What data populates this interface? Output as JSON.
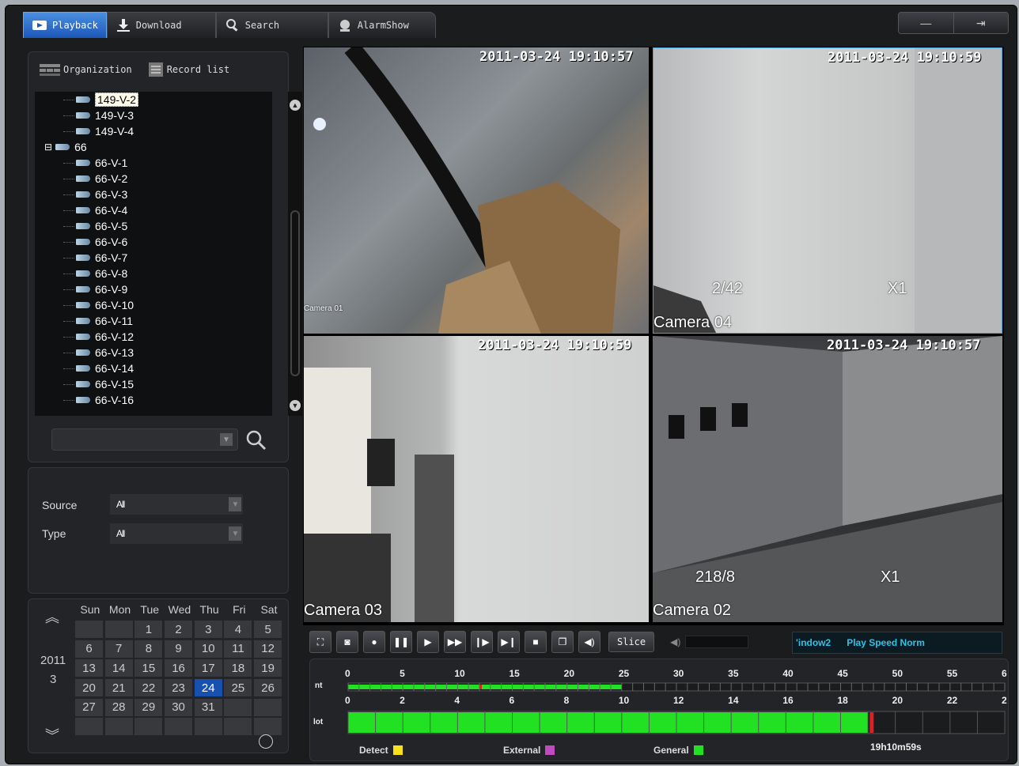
{
  "tabs": [
    {
      "label": "Playback",
      "icon": "playback-icon"
    },
    {
      "label": "Download",
      "icon": "download-icon"
    },
    {
      "label": "Search",
      "icon": "search-icon"
    },
    {
      "label": "AlarmShow",
      "icon": "alarm-icon"
    }
  ],
  "window_controls": {
    "minimize": "—",
    "exit": "⇥"
  },
  "org": {
    "tab_org": "Organization",
    "tab_record": "Record list"
  },
  "tree": [
    {
      "label": "149-V-2",
      "level": 2,
      "selected": true
    },
    {
      "label": "149-V-3",
      "level": 2
    },
    {
      "label": "149-V-4",
      "level": 2
    },
    {
      "label": "66",
      "level": 1,
      "group": true
    },
    {
      "label": "66-V-1",
      "level": 2
    },
    {
      "label": "66-V-2",
      "level": 2
    },
    {
      "label": "66-V-3",
      "level": 2
    },
    {
      "label": "66-V-4",
      "level": 2
    },
    {
      "label": "66-V-5",
      "level": 2
    },
    {
      "label": "66-V-6",
      "level": 2
    },
    {
      "label": "66-V-7",
      "level": 2
    },
    {
      "label": "66-V-8",
      "level": 2
    },
    {
      "label": "66-V-9",
      "level": 2
    },
    {
      "label": "66-V-10",
      "level": 2
    },
    {
      "label": "66-V-11",
      "level": 2
    },
    {
      "label": "66-V-12",
      "level": 2
    },
    {
      "label": "66-V-13",
      "level": 2
    },
    {
      "label": "66-V-14",
      "level": 2
    },
    {
      "label": "66-V-15",
      "level": 2
    },
    {
      "label": "66-V-16",
      "level": 2
    }
  ],
  "filters": {
    "source_label": "Source",
    "source_value": "All",
    "type_label": "Type",
    "type_value": "All"
  },
  "calendar": {
    "year": "2011",
    "month": "3",
    "weekdays": [
      "Sun",
      "Mon",
      "Tue",
      "Wed",
      "Thu",
      "Fri",
      "Sat"
    ],
    "days": [
      "",
      "",
      "1",
      "2",
      "3",
      "4",
      "5",
      "6",
      "7",
      "8",
      "9",
      "10",
      "11",
      "12",
      "13",
      "14",
      "15",
      "16",
      "17",
      "18",
      "19",
      "20",
      "21",
      "22",
      "23",
      "24",
      "25",
      "26",
      "27",
      "28",
      "29",
      "30",
      "31",
      "",
      "",
      "",
      "",
      "",
      "",
      "",
      "",
      ""
    ],
    "selected": "24"
  },
  "videos": {
    "v1": {
      "timestamp": "2011-03-24 19:10:57",
      "label": "Camera 01"
    },
    "v2": {
      "timestamp": "2011-03-24 19:10:59",
      "label": "Camera 04",
      "frames": "2/42",
      "speed": "X1"
    },
    "v3": {
      "timestamp": "2011-03-24 19:10:59",
      "label": "Camera 03"
    },
    "v4": {
      "timestamp": "2011-03-24 19:10:57",
      "label": "Camera 02",
      "frames": "218/8",
      "speed": "X1"
    }
  },
  "controls": {
    "slice_label": "Slice",
    "lcd_window": "'indow2",
    "lcd_speed": "Play Speed Norm"
  },
  "timeline": {
    "row1_label": "nt",
    "row2_label": "lot",
    "scale1": [
      "0",
      "5",
      "10",
      "15",
      "20",
      "25",
      "30",
      "35",
      "40",
      "45",
      "50",
      "55",
      "6"
    ],
    "scale2": [
      "0",
      "2",
      "4",
      "6",
      "8",
      "10",
      "12",
      "14",
      "16",
      "18",
      "20",
      "22",
      "2"
    ],
    "time": "19h10m59s",
    "legend": [
      {
        "label": "Detect",
        "color": "#f7e11a"
      },
      {
        "label": "External",
        "color": "#c04ac0"
      },
      {
        "label": "General",
        "color": "#22e022"
      }
    ]
  }
}
